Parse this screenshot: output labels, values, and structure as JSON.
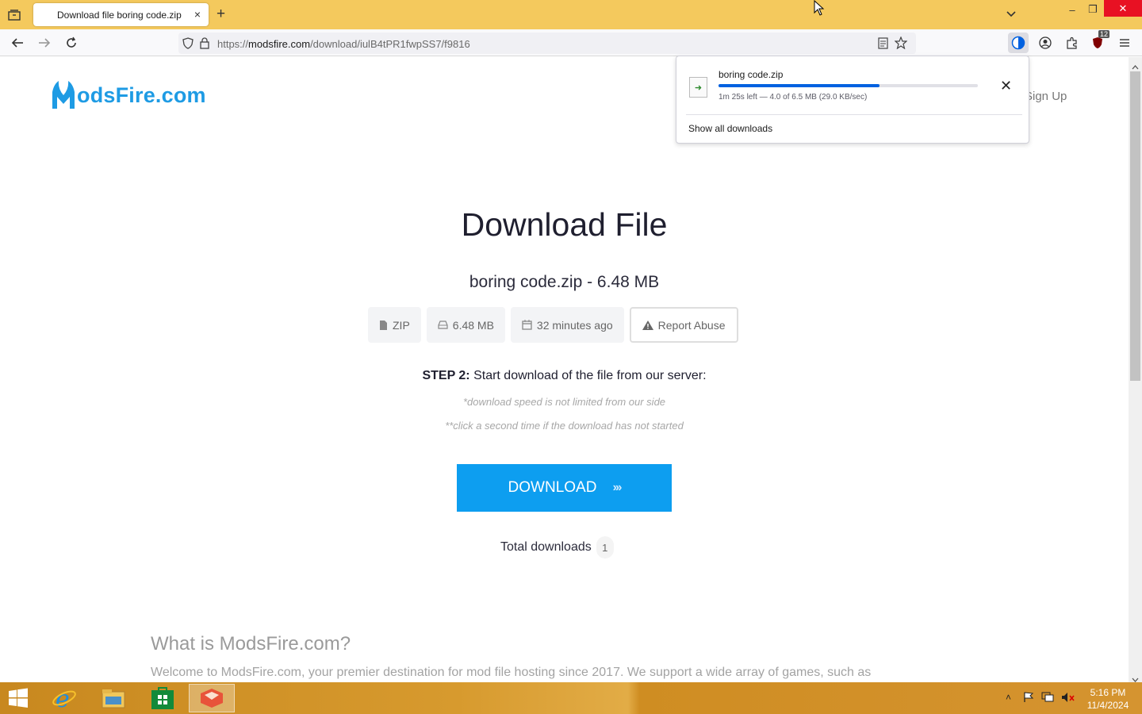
{
  "browser": {
    "tab_title": "Download file boring code.zip",
    "new_tab": "+",
    "tab_close": "×",
    "url_prefix": "https://",
    "url_host": "modsfire.com",
    "url_path": "/download/iulB4tPR1fwpSS7/f9816",
    "extension_badge": "12",
    "window_buttons": {
      "minimize": "–",
      "restore": "❐",
      "close": "✕"
    }
  },
  "site": {
    "logo_text": "odsFire.com",
    "logo_initial": "M",
    "sign_up": "Sign Up"
  },
  "main": {
    "heading": "Download File",
    "file_line": "boring code.zip - 6.48 MB",
    "chips": {
      "type": "ZIP",
      "size": "6.48 MB",
      "age": "32 minutes ago",
      "report": "Report Abuse"
    },
    "step_label": "STEP 2:",
    "step_text": " Start download of the file from our server:",
    "note1": "*download speed is not limited from our side",
    "note2": "**click a second time if the download has not started",
    "download_button": "DOWNLOAD",
    "download_arrows": "›››",
    "total_label": "Total downloads",
    "total_count": "1"
  },
  "about": {
    "heading": "What is ModsFire.com?",
    "text": "Welcome to ModsFire.com, your premier destination for mod file hosting since 2017. We support a wide array of games, such as"
  },
  "download_panel": {
    "file_name": "boring code.zip",
    "progress_fraction": 0.62,
    "status": "1m 25s left — 4.0 of 6.5 MB (29.0 KB/sec)",
    "close": "✕",
    "show_all": "Show all downloads"
  },
  "taskbar": {
    "time": "5:16 PM",
    "date": "11/4/2024"
  },
  "colors": {
    "tabbar": "#f4c95d",
    "accent": "#0d9ef0",
    "logo": "#1e9be4",
    "progress": "#0061e0"
  }
}
